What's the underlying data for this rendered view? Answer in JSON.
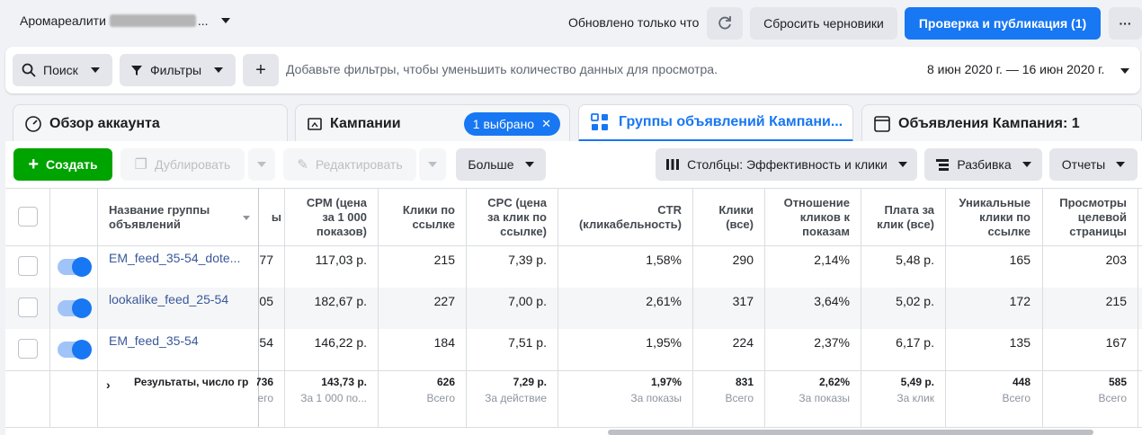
{
  "topbar": {
    "account_name": "Аромареалити",
    "account_suffix": "...",
    "updated_text": "Обновлено только что",
    "reset_label": "Сбросить черновики",
    "publish_label": "Проверка и публикация (1)",
    "more_label": "···"
  },
  "filterbar": {
    "search_label": "Поиск",
    "filters_label": "Фильтры",
    "add_label": "+",
    "hint": "Добавьте фильтры, чтобы уменьшить количество данных для просмотра.",
    "date_range": "8 июн 2020 г. — 16 июн 2020 г."
  },
  "tabs": [
    {
      "label": "Обзор аккаунта"
    },
    {
      "label": "Кампании",
      "badge": "1 выбрано"
    },
    {
      "label": "Группы объявлений Кампани..."
    },
    {
      "label": "Объявления Кампания: 1"
    }
  ],
  "toolbar": {
    "create_label": "Создать",
    "duplicate_label": "Дублировать",
    "edit_label": "Редактировать",
    "more_label": "Больше",
    "columns_label": "Столбцы: Эффективность и клики",
    "breakdown_label": "Разбивка",
    "reports_label": "Отчеты"
  },
  "table": {
    "name_header": "Название группы объявлений",
    "headers": {
      "cpm": "CPM (цена за 1 000 показов)",
      "link_clicks": "Клики по ссылке",
      "cpc": "CPC (цена за клик по ссылке)",
      "ctr": "CTR (кликабельность)",
      "clicks_all": "Клики (все)",
      "click_ratio": "Отношение кликов к показам",
      "cpc_all": "Плата за клик (все)",
      "unique_clicks": "Уникальные клики по ссылке",
      "landing_views": "Просмотры целевой страницы"
    },
    "rows": [
      {
        "name": "EM_feed_35-54_dote...",
        "prev": "77",
        "cpm": "117,03 р.",
        "link_clicks": "215",
        "cpc": "7,39 р.",
        "ctr": "1,58%",
        "clicks_all": "290",
        "click_ratio": "2,14%",
        "cpc_all": "5,48 р.",
        "unique_clicks": "165",
        "landing_views": "203"
      },
      {
        "name": "lookalike_feed_25-54",
        "prev": "05",
        "cpm": "182,67 р.",
        "link_clicks": "227",
        "cpc": "7,00 р.",
        "ctr": "2,61%",
        "clicks_all": "317",
        "click_ratio": "3,64%",
        "cpc_all": "5,02 р.",
        "unique_clicks": "172",
        "landing_views": "215"
      },
      {
        "name": "EM_feed_35-54",
        "prev": "54",
        "cpm": "146,22 р.",
        "link_clicks": "184",
        "cpc": "7,51 р.",
        "ctr": "1,95%",
        "clicks_all": "224",
        "click_ratio": "2,37%",
        "cpc_all": "6,17 р.",
        "unique_clicks": "135",
        "landing_views": "167"
      }
    ],
    "totals": {
      "label": "Результаты, число гр",
      "prev": "736",
      "prev_sub": "Всего",
      "cpm": "143,73 р.",
      "cpm_sub": "За 1 000 по...",
      "link_clicks": "626",
      "link_clicks_sub": "Всего",
      "cpc": "7,29 р.",
      "cpc_sub": "За действие",
      "ctr": "1,97%",
      "ctr_sub": "За показы",
      "clicks_all": "831",
      "clicks_all_sub": "Всего",
      "click_ratio": "2,62%",
      "click_ratio_sub": "За показы",
      "cpc_all": "5,49 р.",
      "cpc_all_sub": "За клик",
      "unique_clicks": "448",
      "unique_clicks_sub": "Всего",
      "landing_views": "585",
      "landing_views_sub": "Всего"
    }
  },
  "colors": {
    "accent": "#1877f2",
    "create": "#00a400"
  }
}
